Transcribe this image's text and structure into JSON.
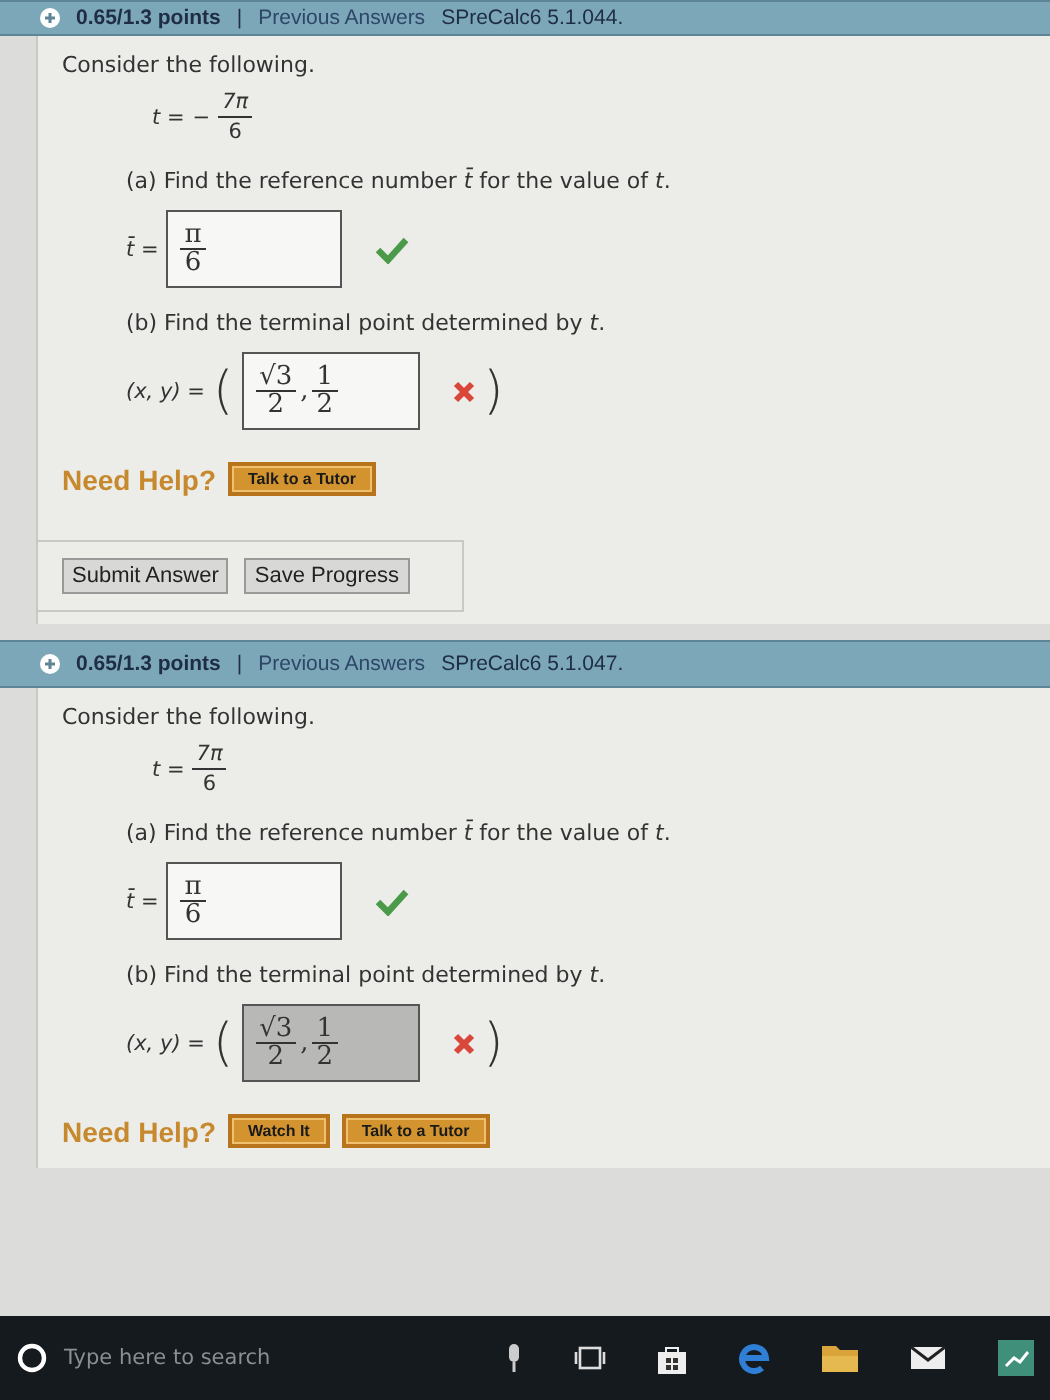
{
  "problems": [
    {
      "header": {
        "points": "0.65/1.3 points",
        "divider": "|",
        "previous": "Previous Answers",
        "code": "SPreCalc6 5.1.044."
      },
      "prompt": "Consider the following.",
      "given": {
        "lhs": "t =",
        "sign": "−",
        "num": "7π",
        "den": "6"
      },
      "parts": [
        {
          "label": "(a) Find the reference number *t̄* for the value of *t*.",
          "lhs": "t̄ =",
          "fractions": [
            {
              "num": "π",
              "den": "6"
            }
          ],
          "highlighted": false,
          "correct": true
        },
        {
          "label": "(b) Find the terminal point determined by *t*.",
          "lhs": "(x, y) =",
          "open": "(",
          "close": ")",
          "fractions": [
            {
              "num": "√3",
              "den": "2"
            },
            {
              "num": "1",
              "den": "2"
            }
          ],
          "separator": ",",
          "highlighted": false,
          "correct": false
        }
      ],
      "help": {
        "label": "Need Help?",
        "buttons": [
          "Talk to a Tutor"
        ]
      },
      "actions": [
        "Submit Answer",
        "Save Progress"
      ]
    },
    {
      "header": {
        "points": "0.65/1.3 points",
        "divider": "|",
        "previous": "Previous Answers",
        "code": "SPreCalc6 5.1.047."
      },
      "prompt": "Consider the following.",
      "given": {
        "lhs": "t =",
        "num": "7π",
        "den": "6"
      },
      "parts": [
        {
          "label": "(a) Find the reference number *t̄* for the value of *t*.",
          "lhs": "t̄ =",
          "fractions": [
            {
              "num": "π",
              "den": "6"
            }
          ],
          "highlighted": false,
          "correct": true
        },
        {
          "label": "(b) Find the terminal point determined by *t*.",
          "lhs": "(x, y) =",
          "open": "(",
          "close": ")",
          "fractions": [
            {
              "num": "√3",
              "den": "2"
            },
            {
              "num": "1",
              "den": "2"
            }
          ],
          "separator": ",",
          "highlighted": true,
          "correct": false
        }
      ],
      "help": {
        "label": "Need Help?",
        "buttons": [
          "Watch It",
          "Talk to a Tutor"
        ]
      }
    }
  ],
  "taskbar": {
    "search_placeholder": "Type here to search"
  }
}
